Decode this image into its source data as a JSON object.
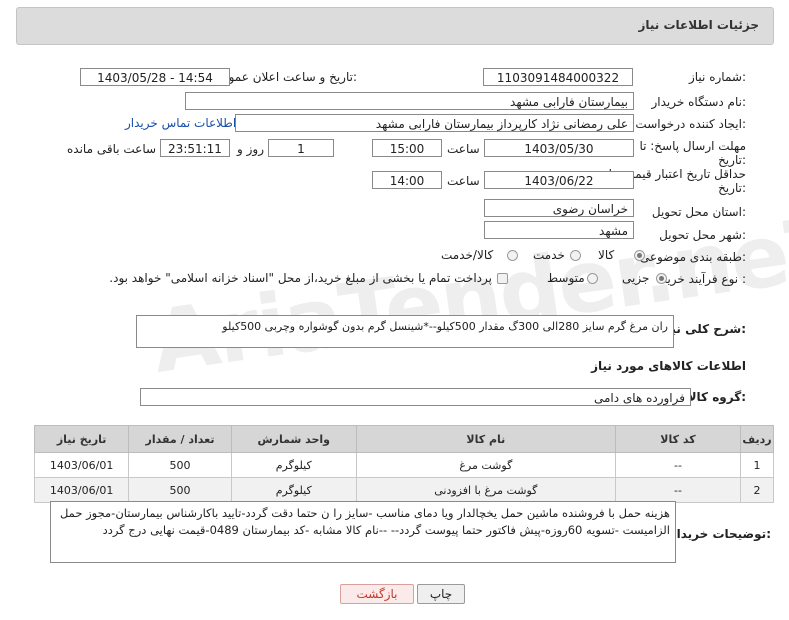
{
  "header": {
    "title": "جزئیات اطلاعات نیاز"
  },
  "form": {
    "need_number": {
      "label": "شماره نیاز:",
      "value": "1103091484000322"
    },
    "announce_datetime": {
      "label": "تاریخ و ساعت اعلان عمومی:",
      "value": "1403/05/28 - 14:54"
    },
    "buyer_org": {
      "label": "نام دستگاه خریدار:",
      "value": "بیمارستان فارابی مشهد"
    },
    "requester": {
      "label": "ایجاد کننده درخواست:",
      "value": "علی رمضانی نژاد کارپرداز بیمارستان فارابی مشهد",
      "contact_link": "اطلاعات تماس خریدار"
    },
    "reply_deadline": {
      "label_line1": "مهلت ارسال پاسخ: تا",
      "label_line2": "تاریخ:",
      "date": "1403/05/30",
      "time_label": "ساعت",
      "time": "15:00",
      "days": "1",
      "days_label": "روز و",
      "remaining": "23:51:11",
      "remaining_label": "ساعت باقی مانده"
    },
    "price_validity": {
      "label_line1": "حداقل تاریخ اعتبار قیمت: تا",
      "label_line2": "تاریخ:",
      "date": "1403/06/22",
      "time_label": "ساعت",
      "time": "14:00"
    },
    "province": {
      "label": "استان محل تحویل:",
      "value": "خراسان رضوی"
    },
    "city": {
      "label": "شهر محل تحویل:",
      "value": "مشهد"
    },
    "category": {
      "label": "طبقه بندی موضوعی:",
      "options": [
        "کالا",
        "خدمت",
        "کالا/خدمت"
      ],
      "selected": "کالا"
    },
    "purchase_type": {
      "label": "نوع فرآیند خرید :",
      "options": [
        "جزیی",
        "متوسط"
      ],
      "selected": "جزیی",
      "treasury_note": "پرداخت تمام یا بخشی از مبلغ خرید،از محل \"اسناد خزانه اسلامی\" خواهد بود."
    },
    "description": {
      "label": "شرح کلی نیاز:",
      "value": "ران مرغ گرم سایز 280الی 300گ مقدار 500کیلو--*شینسل گرم  بدون گوشواره وچربی 500کیلو"
    }
  },
  "goods": {
    "section_title": "اطلاعات کالاهای مورد نیاز",
    "group_label": "گروه کالا:",
    "group_value": "فراورده های دامی",
    "columns": [
      "ردیف",
      "کد کالا",
      "نام کالا",
      "واحد شمارش",
      "تعداد / مقدار",
      "تاریخ نیاز"
    ],
    "rows": [
      {
        "row": "1",
        "code": "--",
        "name": "گوشت مرغ",
        "unit": "کیلوگرم",
        "qty": "500",
        "date": "1403/06/01"
      },
      {
        "row": "2",
        "code": "--",
        "name": "گوشت مرغ با افزودنی",
        "unit": "کیلوگرم",
        "qty": "500",
        "date": "1403/06/01"
      }
    ]
  },
  "buyer_notes": {
    "label": "توضیحات خریدار:",
    "text": "هزینه حمل با فروشنده ماشین حمل یخچالدار ویا دمای مناسب -سایز را ن حتما دقت گردد-تایید باکارشناس بیمارستان-مجوز حمل الزامیست -تسویه 60روزه-پیش فاکتور حتما پیوست گردد-- --نام کالا مشابه -کد بیمارستان 0489-قیمت نهایی درج گردد"
  },
  "buttons": {
    "print": "چاپ",
    "back": "بازگشت"
  },
  "watermark": "AriaTender.neT"
}
